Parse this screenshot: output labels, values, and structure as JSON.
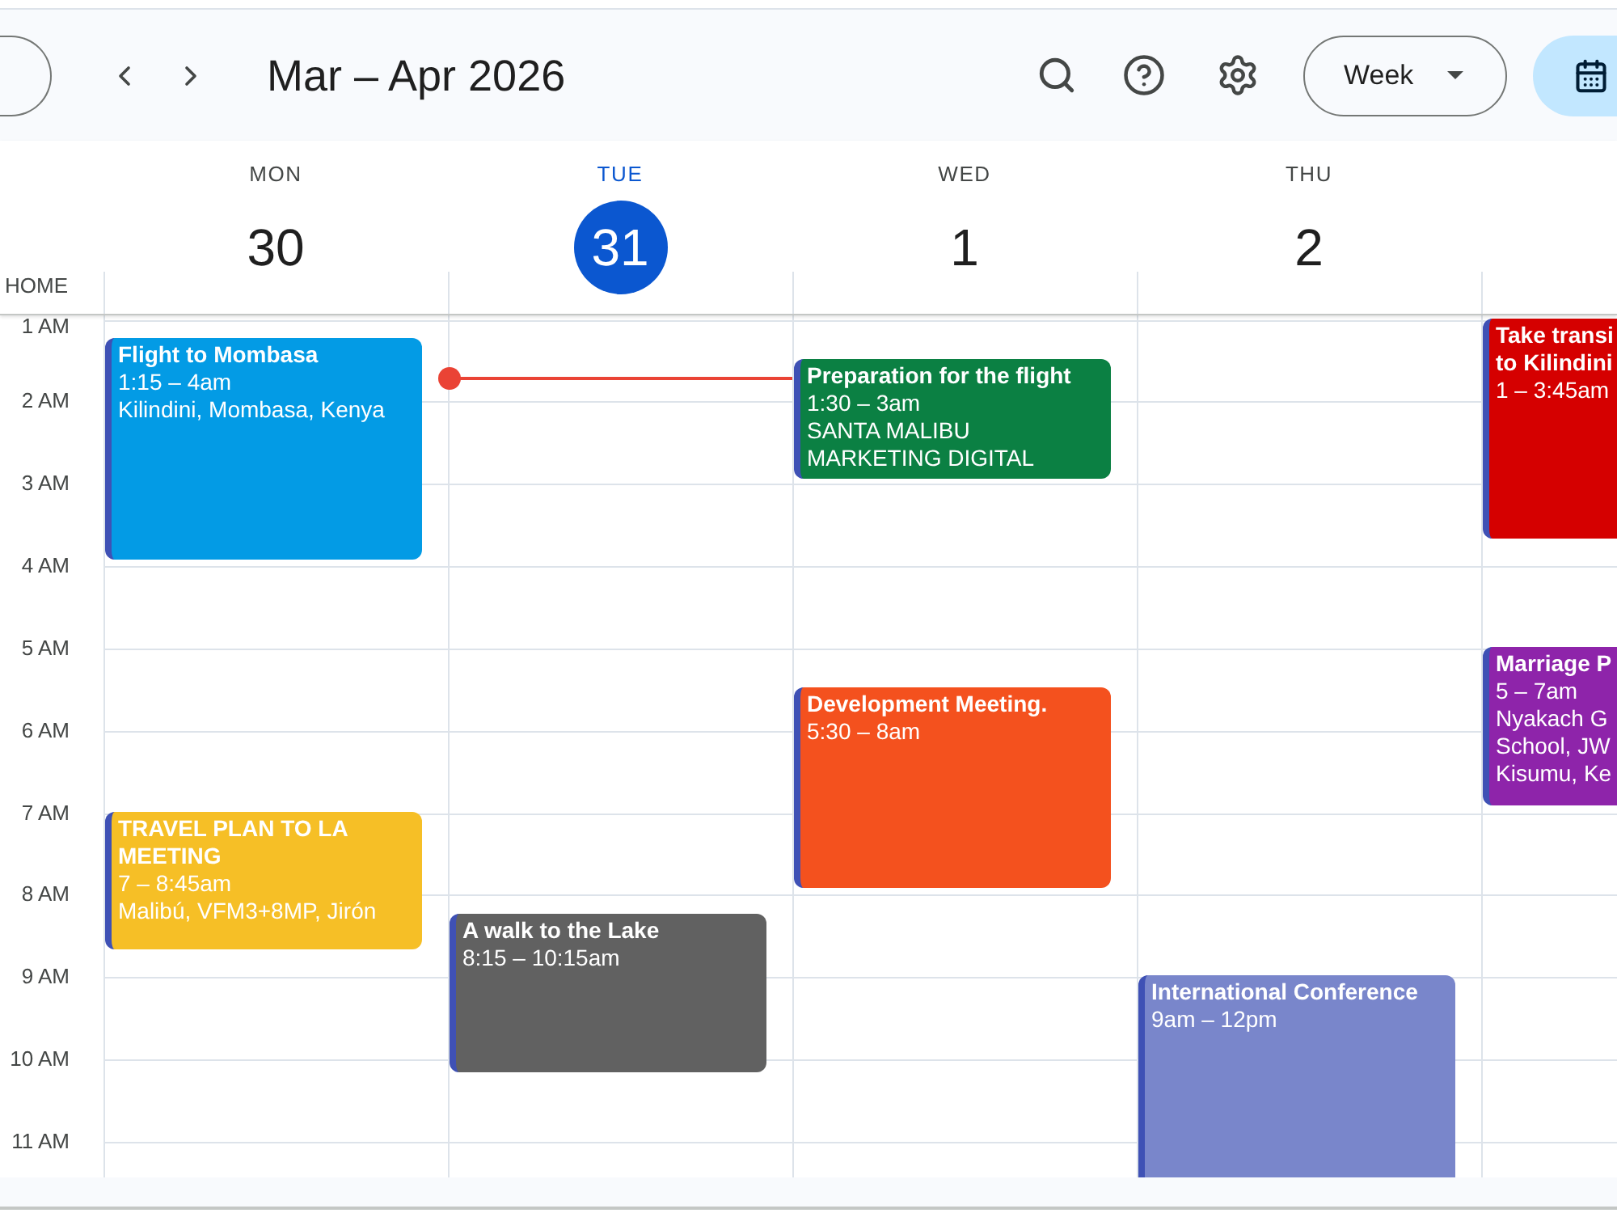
{
  "toolbar": {
    "title": "Mar – Apr 2026",
    "view_selector": "Week"
  },
  "timezone_label": "HOME",
  "hours": [
    "1 AM",
    "2 AM",
    "3 AM",
    "4 AM",
    "5 AM",
    "6 AM",
    "7 AM",
    "8 AM",
    "9 AM",
    "10 AM",
    "11 AM"
  ],
  "days": [
    {
      "name": "MON",
      "date": "30",
      "today": false,
      "events": [
        {
          "title_lines": [
            "Flight to Mombasa"
          ],
          "time": "1:15 – 4am",
          "location_lines": [
            "Kilindini, Mombasa, Kenya"
          ],
          "color": "#039be5"
        },
        {
          "title_lines": [
            "TRAVEL PLAN TO LA",
            "MEETING"
          ],
          "time": "7 – 8:45am",
          "location_lines": [
            "Malibú, VFM3+8MP, Jirón"
          ],
          "color": "#f6bf26"
        }
      ]
    },
    {
      "name": "TUE",
      "date": "31",
      "today": true,
      "events": [
        {
          "title_lines": [
            "A walk to the Lake"
          ],
          "time": "8:15 – 10:15am",
          "color": "#616161"
        }
      ]
    },
    {
      "name": "WED",
      "date": "1",
      "today": false,
      "events": [
        {
          "title_lines": [
            "Preparation for the flight"
          ],
          "time": "1:30 – 3am",
          "location_lines": [
            "SANTA MALIBU",
            "MARKETING DIGITAL"
          ],
          "color": "#0b8043"
        },
        {
          "title_lines": [
            "Development Meeting."
          ],
          "time": "5:30 – 8am",
          "color": "#f4511e"
        }
      ]
    },
    {
      "name": "THU",
      "date": "2",
      "today": false,
      "events": [
        {
          "title_lines": [
            "International Conference"
          ],
          "time": "9am – 12pm",
          "color": "#7986cb"
        }
      ]
    },
    {
      "events": [
        {
          "title_lines": [
            "Take transi",
            "to Kilindini"
          ],
          "time": "1 – 3:45am",
          "color": "#d50000"
        },
        {
          "title_lines": [
            "Marriage P"
          ],
          "time": "5 – 7am",
          "location_lines": [
            "Nyakach G",
            "School, JW",
            "Kisumu, Ke"
          ],
          "color": "#8e24aa"
        }
      ]
    }
  ]
}
